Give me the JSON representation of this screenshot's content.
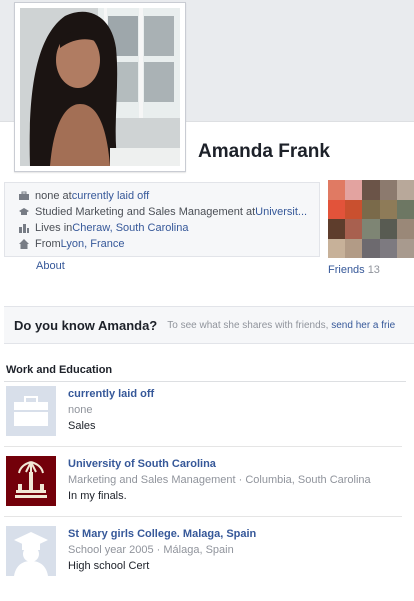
{
  "profile": {
    "name": "Amanda Frank"
  },
  "intro": {
    "work": {
      "prefix": "none at ",
      "link": "currently laid off"
    },
    "education": {
      "prefix": "Studied Marketing and Sales Management at ",
      "link": "Universit..."
    },
    "lives": {
      "prefix": "Lives in ",
      "link": "Cheraw, South Carolina"
    },
    "from": {
      "prefix": "From ",
      "link": "Lyon, France"
    }
  },
  "about_label": "About",
  "friends": {
    "label": "Friends",
    "count": "13",
    "tile_colors": [
      "#e07a63",
      "#e3a3a0",
      "#6b5448",
      "#8c7a6e",
      "#b8a89a",
      "#e2533a",
      "#c9502f",
      "#7a6a4a",
      "#8e7b58",
      "#6d7763",
      "#5e3d2c",
      "#a8604f",
      "#7e8574",
      "#585b52",
      "#9a8878",
      "#c7b199",
      "#b29b86",
      "#6d6a6f",
      "#7d7a80",
      "#a89a8e"
    ]
  },
  "know_bar": {
    "title": "Do you know Amanda?",
    "prompt": "To see what she shares with friends, ",
    "link": "send her a frie"
  },
  "work_education": {
    "heading": "Work and Education",
    "items": [
      {
        "title": "currently laid off",
        "meta": "none",
        "desc": "Sales",
        "icon": "briefcase-icon"
      },
      {
        "title": "University of South Carolina",
        "meta": "Marketing and Sales Management · Columbia, South Carolina",
        "desc": "In my finals.",
        "icon": "university-crest-icon"
      },
      {
        "title": "St Mary girls College. Malaga, Spain",
        "meta": "School year 2005 · Málaga, Spain",
        "desc": "High school Cert",
        "icon": "graduate-icon"
      }
    ]
  },
  "colors": {
    "link": "#365899",
    "muted": "#90949c",
    "panel": "#f6f7f9",
    "usc_garnet": "#73000a"
  }
}
